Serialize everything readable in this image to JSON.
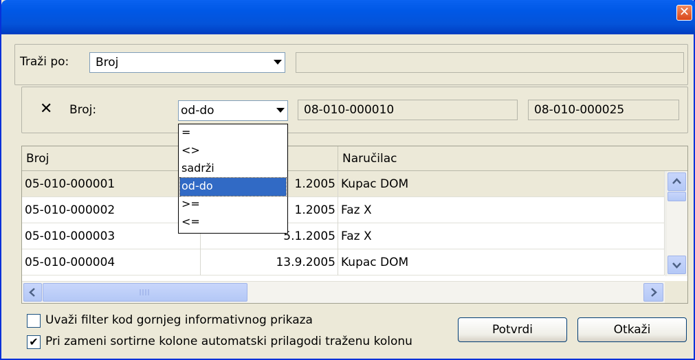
{
  "window": {
    "close_glyph": "✕"
  },
  "search": {
    "label": "Traži po:",
    "combo_value": "Broj",
    "text_value": ""
  },
  "filter": {
    "remove_glyph": "✕",
    "label": "Broj:",
    "operator": "od-do",
    "from_value": "08-010-000010",
    "to_value": "08-010-000025"
  },
  "dropdown": {
    "options": [
      "=",
      "<>",
      "sadrži",
      "od-do",
      ">=",
      "<="
    ],
    "selected_index": 3
  },
  "table": {
    "columns": [
      "Broj",
      "",
      "Naručilac"
    ],
    "rows": [
      {
        "broj": "05-010-000001",
        "datum": "1.2005",
        "narucilac": "Kupac DOM"
      },
      {
        "broj": "05-010-000002",
        "datum": "1.2005",
        "narucilac": "Faz X"
      },
      {
        "broj": "05-010-000003",
        "datum": "5.1.2005",
        "narucilac": "Faz X"
      },
      {
        "broj": "05-010-000004",
        "datum": "13.9.2005",
        "narucilac": "Kupac DOM"
      }
    ]
  },
  "options": {
    "apply_filter_label": "Uvaži filter kod gornjeg informativnog prikaza",
    "apply_filter_checked": false,
    "auto_sort_label": "Pri zameni sortirne kolone automatski prilagodi traženu kolonu",
    "auto_sort_checked": true
  },
  "buttons": {
    "confirm": "Potvrdi",
    "cancel": "Otkaži"
  },
  "colors": {
    "title_bar": "#0058e6",
    "dialog_bg": "#ECE9D8",
    "selection": "#316ac5"
  }
}
